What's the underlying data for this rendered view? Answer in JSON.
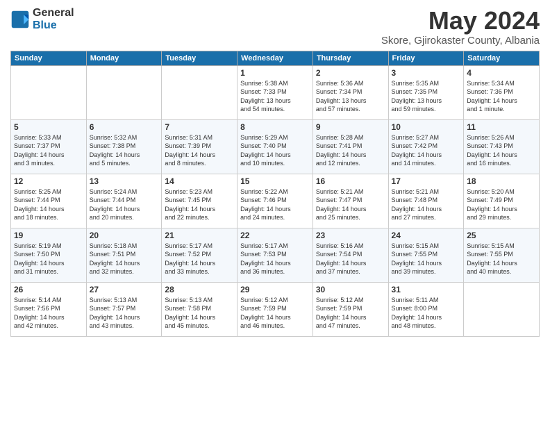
{
  "header": {
    "logo_general": "General",
    "logo_blue": "Blue",
    "month": "May 2024",
    "location": "Skore, Gjirokaster County, Albania"
  },
  "days": [
    "Sunday",
    "Monday",
    "Tuesday",
    "Wednesday",
    "Thursday",
    "Friday",
    "Saturday"
  ],
  "weeks": [
    [
      {
        "date": "",
        "info": ""
      },
      {
        "date": "",
        "info": ""
      },
      {
        "date": "",
        "info": ""
      },
      {
        "date": "1",
        "info": "Sunrise: 5:38 AM\nSunset: 7:33 PM\nDaylight: 13 hours\nand 54 minutes."
      },
      {
        "date": "2",
        "info": "Sunrise: 5:36 AM\nSunset: 7:34 PM\nDaylight: 13 hours\nand 57 minutes."
      },
      {
        "date": "3",
        "info": "Sunrise: 5:35 AM\nSunset: 7:35 PM\nDaylight: 13 hours\nand 59 minutes."
      },
      {
        "date": "4",
        "info": "Sunrise: 5:34 AM\nSunset: 7:36 PM\nDaylight: 14 hours\nand 1 minute."
      }
    ],
    [
      {
        "date": "5",
        "info": "Sunrise: 5:33 AM\nSunset: 7:37 PM\nDaylight: 14 hours\nand 3 minutes."
      },
      {
        "date": "6",
        "info": "Sunrise: 5:32 AM\nSunset: 7:38 PM\nDaylight: 14 hours\nand 5 minutes."
      },
      {
        "date": "7",
        "info": "Sunrise: 5:31 AM\nSunset: 7:39 PM\nDaylight: 14 hours\nand 8 minutes."
      },
      {
        "date": "8",
        "info": "Sunrise: 5:29 AM\nSunset: 7:40 PM\nDaylight: 14 hours\nand 10 minutes."
      },
      {
        "date": "9",
        "info": "Sunrise: 5:28 AM\nSunset: 7:41 PM\nDaylight: 14 hours\nand 12 minutes."
      },
      {
        "date": "10",
        "info": "Sunrise: 5:27 AM\nSunset: 7:42 PM\nDaylight: 14 hours\nand 14 minutes."
      },
      {
        "date": "11",
        "info": "Sunrise: 5:26 AM\nSunset: 7:43 PM\nDaylight: 14 hours\nand 16 minutes."
      }
    ],
    [
      {
        "date": "12",
        "info": "Sunrise: 5:25 AM\nSunset: 7:44 PM\nDaylight: 14 hours\nand 18 minutes."
      },
      {
        "date": "13",
        "info": "Sunrise: 5:24 AM\nSunset: 7:44 PM\nDaylight: 14 hours\nand 20 minutes."
      },
      {
        "date": "14",
        "info": "Sunrise: 5:23 AM\nSunset: 7:45 PM\nDaylight: 14 hours\nand 22 minutes."
      },
      {
        "date": "15",
        "info": "Sunrise: 5:22 AM\nSunset: 7:46 PM\nDaylight: 14 hours\nand 24 minutes."
      },
      {
        "date": "16",
        "info": "Sunrise: 5:21 AM\nSunset: 7:47 PM\nDaylight: 14 hours\nand 25 minutes."
      },
      {
        "date": "17",
        "info": "Sunrise: 5:21 AM\nSunset: 7:48 PM\nDaylight: 14 hours\nand 27 minutes."
      },
      {
        "date": "18",
        "info": "Sunrise: 5:20 AM\nSunset: 7:49 PM\nDaylight: 14 hours\nand 29 minutes."
      }
    ],
    [
      {
        "date": "19",
        "info": "Sunrise: 5:19 AM\nSunset: 7:50 PM\nDaylight: 14 hours\nand 31 minutes."
      },
      {
        "date": "20",
        "info": "Sunrise: 5:18 AM\nSunset: 7:51 PM\nDaylight: 14 hours\nand 32 minutes."
      },
      {
        "date": "21",
        "info": "Sunrise: 5:17 AM\nSunset: 7:52 PM\nDaylight: 14 hours\nand 33 minutes."
      },
      {
        "date": "22",
        "info": "Sunrise: 5:17 AM\nSunset: 7:53 PM\nDaylight: 14 hours\nand 36 minutes."
      },
      {
        "date": "23",
        "info": "Sunrise: 5:16 AM\nSunset: 7:54 PM\nDaylight: 14 hours\nand 37 minutes."
      },
      {
        "date": "24",
        "info": "Sunrise: 5:15 AM\nSunset: 7:55 PM\nDaylight: 14 hours\nand 39 minutes."
      },
      {
        "date": "25",
        "info": "Sunrise: 5:15 AM\nSunset: 7:55 PM\nDaylight: 14 hours\nand 40 minutes."
      }
    ],
    [
      {
        "date": "26",
        "info": "Sunrise: 5:14 AM\nSunset: 7:56 PM\nDaylight: 14 hours\nand 42 minutes."
      },
      {
        "date": "27",
        "info": "Sunrise: 5:13 AM\nSunset: 7:57 PM\nDaylight: 14 hours\nand 43 minutes."
      },
      {
        "date": "28",
        "info": "Sunrise: 5:13 AM\nSunset: 7:58 PM\nDaylight: 14 hours\nand 45 minutes."
      },
      {
        "date": "29",
        "info": "Sunrise: 5:12 AM\nSunset: 7:59 PM\nDaylight: 14 hours\nand 46 minutes."
      },
      {
        "date": "30",
        "info": "Sunrise: 5:12 AM\nSunset: 7:59 PM\nDaylight: 14 hours\nand 47 minutes."
      },
      {
        "date": "31",
        "info": "Sunrise: 5:11 AM\nSunset: 8:00 PM\nDaylight: 14 hours\nand 48 minutes."
      },
      {
        "date": "",
        "info": ""
      }
    ]
  ]
}
